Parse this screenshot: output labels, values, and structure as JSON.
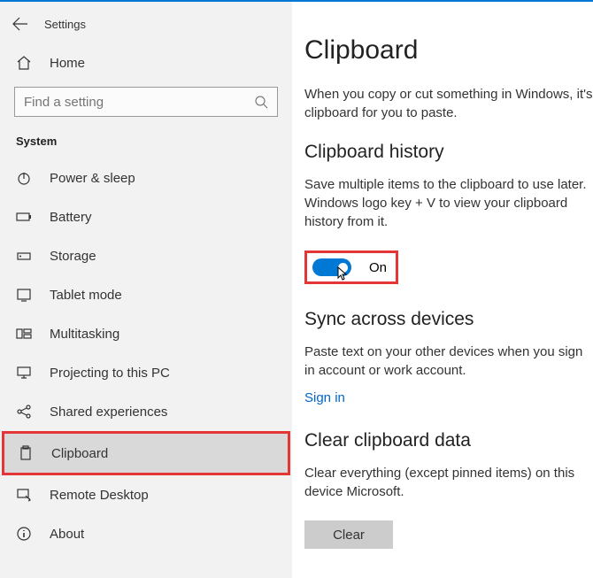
{
  "titlebar": {
    "title": "Settings"
  },
  "home": {
    "label": "Home"
  },
  "search": {
    "placeholder": "Find a setting"
  },
  "section": {
    "label": "System"
  },
  "nav": {
    "items": [
      {
        "label": "Power & sleep"
      },
      {
        "label": "Battery"
      },
      {
        "label": "Storage"
      },
      {
        "label": "Tablet mode"
      },
      {
        "label": "Multitasking"
      },
      {
        "label": "Projecting to this PC"
      },
      {
        "label": "Shared experiences"
      },
      {
        "label": "Clipboard"
      },
      {
        "label": "Remote Desktop"
      },
      {
        "label": "About"
      }
    ]
  },
  "main": {
    "title": "Clipboard",
    "intro": "When you copy or cut something in Windows, it's clipboard for you to paste.",
    "history": {
      "heading": "Clipboard history",
      "body": "Save multiple items to the clipboard to use later. Windows logo key + V to view your clipboard history from it.",
      "toggle_state": "On"
    },
    "sync": {
      "heading": "Sync across devices",
      "body": "Paste text on your other devices when you sign in account or work account.",
      "link": "Sign in"
    },
    "clear": {
      "heading": "Clear clipboard data",
      "body": "Clear everything (except pinned items) on this device Microsoft.",
      "button": "Clear"
    }
  }
}
